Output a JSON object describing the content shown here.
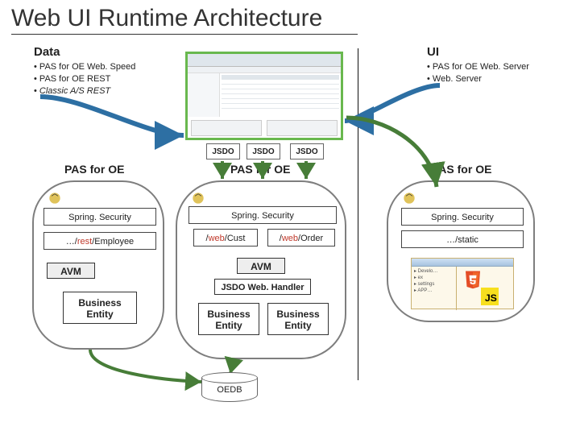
{
  "title": "Web UI Runtime Architecture",
  "data_header": "Data",
  "ui_header": "UI",
  "data_bullets": [
    "PAS for OE Web. Speed",
    "PAS for OE REST",
    "Classic A/S REST"
  ],
  "ui_bullets": [
    "PAS for OE Web. Server",
    "Web. Server"
  ],
  "jsdo_tag": "JSDO",
  "left": {
    "title": "PAS for OE",
    "spring": "Spring. Security",
    "rest_pre": "…/",
    "rest_mid": "rest",
    "rest_post": "/Employee",
    "avm": "AVM",
    "biz": "Business Entity"
  },
  "mid": {
    "title": "PAS for OE",
    "spring": "Spring. Security",
    "web1_pre": "/",
    "web1_mid": "web",
    "web1_post": "/Cust",
    "web2_pre": "/",
    "web2_mid": "web",
    "web2_post": "/Order",
    "avm": "AVM",
    "jsdo": "JSDO Web. Handler",
    "biz": "Business Entity"
  },
  "right": {
    "title": "PAS for OE",
    "spring": "Spring. Security",
    "static": "…/static"
  },
  "db": "OEDB"
}
